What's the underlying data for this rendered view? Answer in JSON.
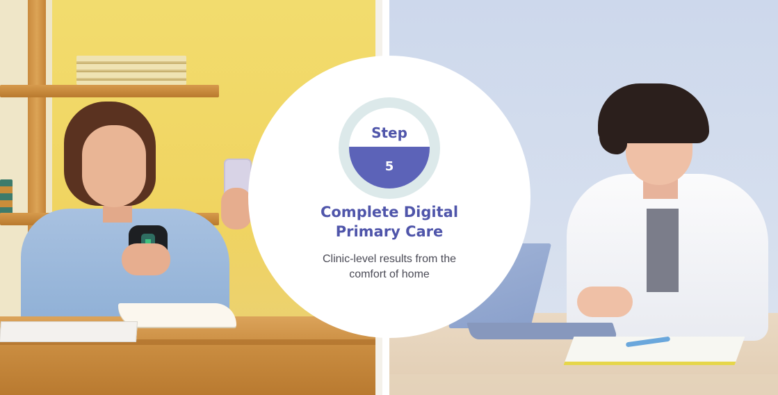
{
  "step": {
    "label": "Step",
    "number": "5"
  },
  "card": {
    "title_line1": "Complete Digital",
    "title_line2": "Primary Care",
    "subtitle_line1": "Clinic-level results from the",
    "subtitle_line2": "comfort of home"
  },
  "colors": {
    "accent": "#5c63b8",
    "heading": "#4f55aa",
    "ring": "#dce9ea",
    "body_text": "#4a4a55"
  },
  "images": {
    "left": "patient-at-home-photo",
    "right": "doctor-at-laptop-photo"
  }
}
